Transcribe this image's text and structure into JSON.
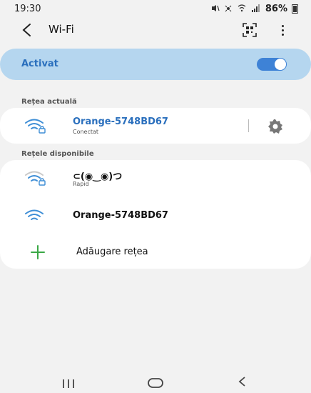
{
  "status_bar": {
    "time": "19:30",
    "battery_percent": "86%",
    "icons": [
      "mute-vibrate-icon",
      "cellular-signal-icon",
      "wifi-calling-icon",
      "signal-strength-icon",
      "battery-icon"
    ]
  },
  "app_bar": {
    "title": "Wi-Fi",
    "back_icon": "back-arrow-icon",
    "qr_icon": "qr-scan-icon",
    "more_icon": "more-vert-icon"
  },
  "master_toggle": {
    "label": "Activat",
    "state": true,
    "accent": "#3e82d6"
  },
  "current_network": {
    "section_label": "Rețea actuală",
    "name": "Orange-5748BD67",
    "status": "Conectat",
    "name_color": "#2a6fbd"
  },
  "available": {
    "section_label": "Rețele disponibile",
    "networks": [
      {
        "name": "⊂(◉‿◉)つ",
        "sub": "Rapid",
        "secured": true
      },
      {
        "name": "Orange-5748BD67",
        "sub": "",
        "secured": false
      }
    ],
    "add_label": "Adăugare rețea",
    "add_color": "#3aa845"
  },
  "nav_bar": {
    "icons": [
      "recent-apps-icon",
      "home-icon",
      "back-icon"
    ]
  }
}
